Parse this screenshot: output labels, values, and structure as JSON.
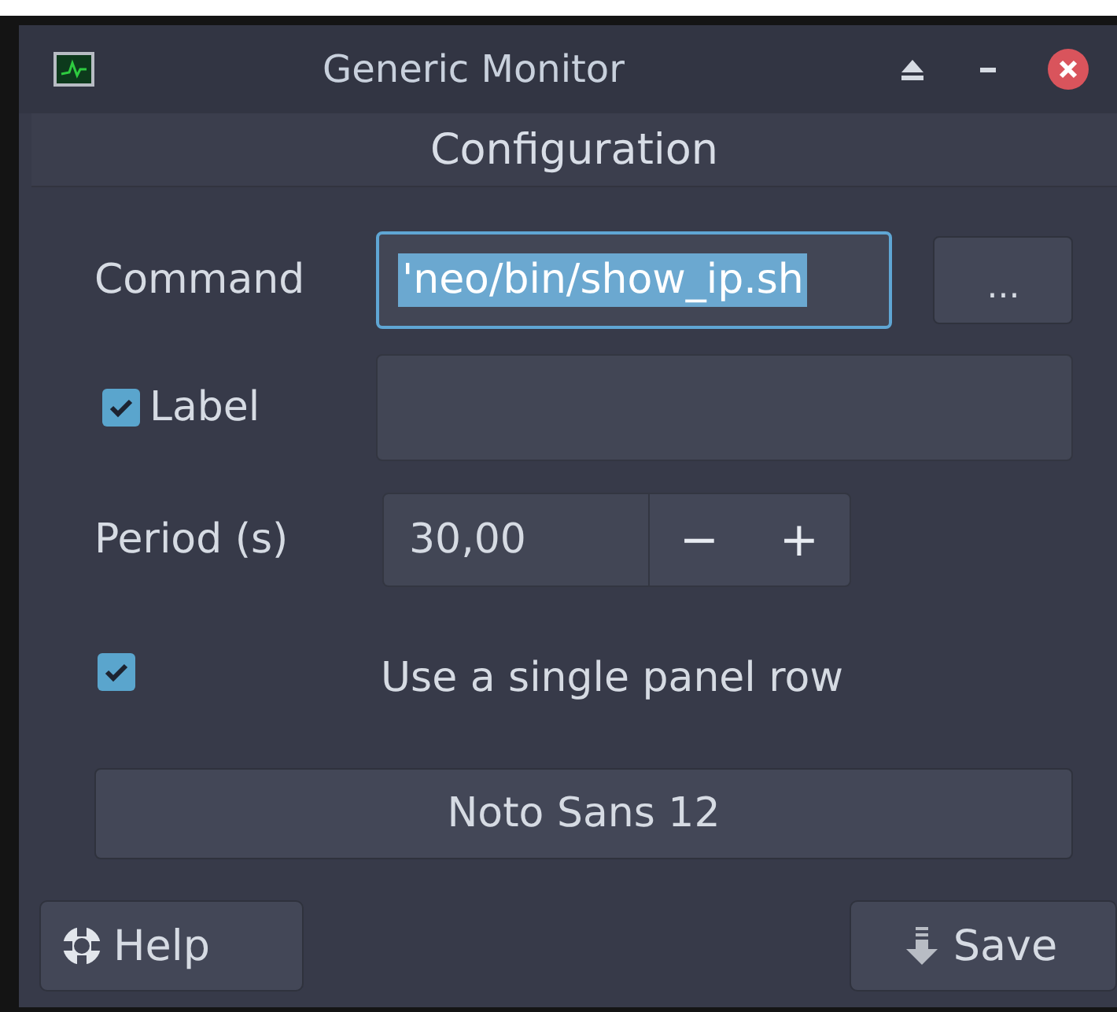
{
  "window": {
    "title": "Generic Monitor"
  },
  "header": {
    "title": "Configuration"
  },
  "command": {
    "label": "Command",
    "value": "'neo/bin/show_ip.sh",
    "selected": true,
    "browse": "..."
  },
  "label_option": {
    "label": "Label",
    "checked": true
  },
  "period": {
    "label": "Period (s)",
    "value": "30,00",
    "decrement": "−",
    "increment": "+"
  },
  "single_row": {
    "label": "Use a single panel row",
    "checked": true
  },
  "font_button": "Noto Sans 12",
  "buttons": [
    {
      "label": "Help",
      "kind": "help"
    },
    {
      "label": "Save",
      "kind": "save"
    }
  ]
}
